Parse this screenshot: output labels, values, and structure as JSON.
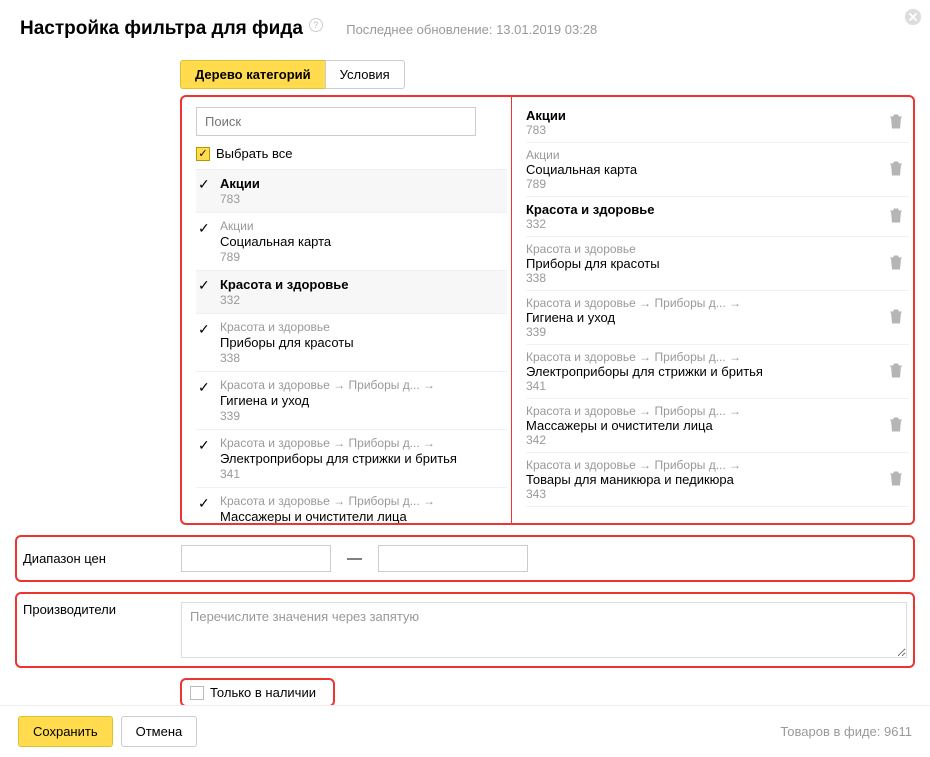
{
  "header": {
    "title": "Настройка фильтра для фида",
    "subtitle": "Последнее обновление: 13.01.2019 03:28"
  },
  "tabs": {
    "tree": "Дерево категорий",
    "conditions": "Условия"
  },
  "search": {
    "placeholder": "Поиск"
  },
  "select_all_label": "Выбрать все",
  "tree_items": [
    {
      "crumb": "",
      "name": "Акции",
      "count": "783",
      "bold": true,
      "top": true
    },
    {
      "crumb": "Акции",
      "name": "Социальная карта",
      "count": "789",
      "bold": false,
      "top": false
    },
    {
      "crumb": "",
      "name": "Красота и здоровье",
      "count": "332",
      "bold": true,
      "top": true
    },
    {
      "crumb": "Красота и здоровье",
      "name": "Приборы для красоты",
      "count": "338",
      "bold": false,
      "top": false
    },
    {
      "crumb": "Красота и здоровье → Приборы д... →",
      "name": "Гигиена и уход",
      "count": "339",
      "bold": false,
      "top": false
    },
    {
      "crumb": "Красота и здоровье → Приборы д... →",
      "name": "Электроприборы для стрижки и бритья",
      "count": "341",
      "bold": false,
      "top": false
    },
    {
      "crumb": "Красота и здоровье → Приборы д... →",
      "name": "Массажеры и очистители лица",
      "count": "",
      "bold": false,
      "top": false
    }
  ],
  "selected_items": [
    {
      "crumb": "",
      "name": "Акции",
      "count": "783",
      "bold": true
    },
    {
      "crumb": "Акции",
      "name": "Социальная карта",
      "count": "789",
      "bold": false
    },
    {
      "crumb": "",
      "name": "Красота и здоровье",
      "count": "332",
      "bold": true
    },
    {
      "crumb": "Красота и здоровье",
      "name": "Приборы для красоты",
      "count": "338",
      "bold": false
    },
    {
      "crumb": "Красота и здоровье → Приборы д... →",
      "name": "Гигиена и уход",
      "count": "339",
      "bold": false
    },
    {
      "crumb": "Красота и здоровье → Приборы д... →",
      "name": "Электроприборы для стрижки и бритья",
      "count": "341",
      "bold": false
    },
    {
      "crumb": "Красота и здоровье → Приборы д... →",
      "name": "Массажеры и очистители лица",
      "count": "342",
      "bold": false
    },
    {
      "crumb": "Красота и здоровье → Приборы д... →",
      "name": "Товары для маникюра и педикюра",
      "count": "343",
      "bold": false
    }
  ],
  "price": {
    "label": "Диапазон цен",
    "from": "",
    "to": ""
  },
  "manufacturers": {
    "label": "Производители",
    "placeholder": "Перечислите значения через запятую"
  },
  "in_stock_label": "Только в наличии",
  "footer": {
    "save": "Сохранить",
    "cancel": "Отмена",
    "feed_count_label": "Товаров в фиде:",
    "feed_count": "9611"
  }
}
